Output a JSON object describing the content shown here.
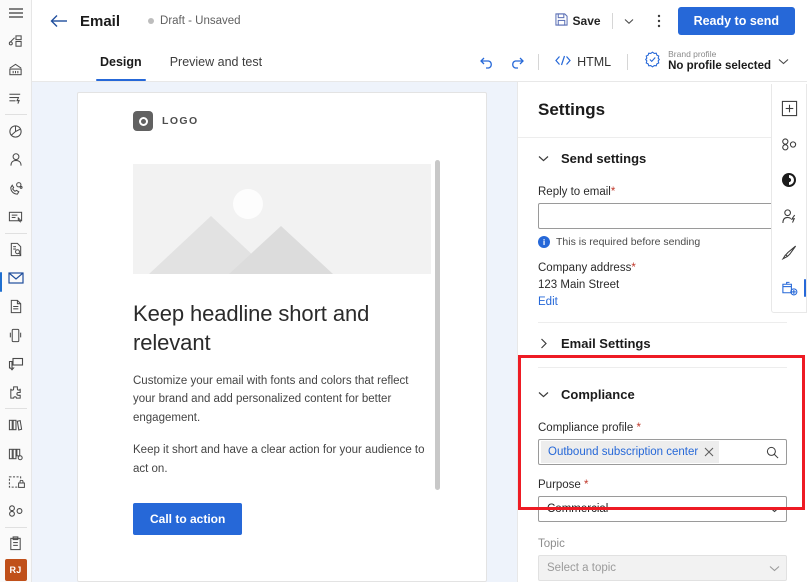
{
  "left_rail": {
    "hamburger_label": "site-map",
    "items": [
      {
        "name": "recent",
        "icon": "pin-recent-icon"
      },
      {
        "name": "pinned",
        "icon": "grid-pinned-icon"
      },
      {
        "name": "quick-campaigns",
        "icon": "lightning-list-icon"
      },
      {
        "name": "dashboards",
        "icon": "pie-chart-icon"
      },
      {
        "name": "contacts",
        "icon": "person-icon"
      },
      {
        "name": "leads",
        "icon": "phone-bubble-icon"
      },
      {
        "name": "forms",
        "icon": "form-icon"
      },
      {
        "name": "reports",
        "icon": "document-search-icon"
      },
      {
        "name": "emails",
        "icon": "envelope-icon"
      },
      {
        "name": "pages",
        "icon": "page-icon"
      },
      {
        "name": "mobile",
        "icon": "mobile-icon"
      },
      {
        "name": "text-messages",
        "icon": "chat-icon"
      },
      {
        "name": "push",
        "icon": "puzzle-icon"
      },
      {
        "name": "library",
        "icon": "books-icon"
      },
      {
        "name": "assets",
        "icon": "books-gear-icon"
      },
      {
        "name": "templates",
        "icon": "template-lock-icon"
      },
      {
        "name": "segments",
        "icon": "segments-icon"
      },
      {
        "name": "tasks",
        "icon": "clipboard-icon"
      }
    ],
    "avatar_initials": "RJ"
  },
  "command_bar": {
    "back_label": "back-arrow",
    "title": "Email",
    "draft_status": "Draft - Unsaved",
    "save_label": "Save",
    "more_label": "more-commands",
    "primary_label": "Ready to send"
  },
  "tabs": {
    "items": [
      {
        "label": "Design",
        "selected": true
      },
      {
        "label": "Preview and test",
        "selected": false
      }
    ],
    "undo_label": "undo",
    "redo_label": "redo",
    "html_label": "HTML",
    "brand_profile_label": "Brand profile",
    "brand_profile_value": "No profile selected"
  },
  "canvas": {
    "logo_text": "LOGO",
    "headline": "Keep headline short and relevant",
    "paragraph1": "Customize your email with fonts and colors that reflect your brand and add personalized content for better engagement.",
    "paragraph2": "Keep it short and have a clear action for your audience to act on.",
    "cta_label": "Call to action"
  },
  "settings": {
    "title": "Settings",
    "collapse_label": "collapse-panel",
    "send_settings": {
      "header": "Send settings",
      "reply_label": "Reply to email",
      "reply_required": "*",
      "reply_value": "",
      "reply_placeholder": "",
      "hint_icon": "i",
      "hint_text": "This is required before sending",
      "company_label": "Company address",
      "company_required": "*",
      "company_value": "123 Main Street",
      "edit_link": "Edit"
    },
    "email_settings": {
      "header": "Email Settings"
    },
    "compliance": {
      "header": "Compliance",
      "profile_label": "Compliance profile",
      "profile_required": "*",
      "profile_value": "Outbound subscription center",
      "clear_label": "clear-selection",
      "search_label": "lookup-search",
      "purpose_label": "Purpose",
      "purpose_required": "*",
      "purpose_value": "Commercial"
    },
    "topic": {
      "label": "Topic",
      "placeholder": "Select a topic"
    }
  },
  "right_rail": {
    "items": [
      {
        "name": "add-element",
        "icon": "add-box-icon"
      },
      {
        "name": "layouts",
        "icon": "layouts-icon"
      },
      {
        "name": "themes",
        "icon": "theme-circle-icon"
      },
      {
        "name": "personalization",
        "icon": "person-lightning-icon"
      },
      {
        "name": "styles",
        "icon": "brush-icon"
      },
      {
        "name": "settings",
        "icon": "settings-panel-icon"
      }
    ]
  },
  "colors": {
    "accent": "#2668d8",
    "highlight": "#ee1b24",
    "avatar": "#c0501a",
    "required": "#c0392b"
  }
}
